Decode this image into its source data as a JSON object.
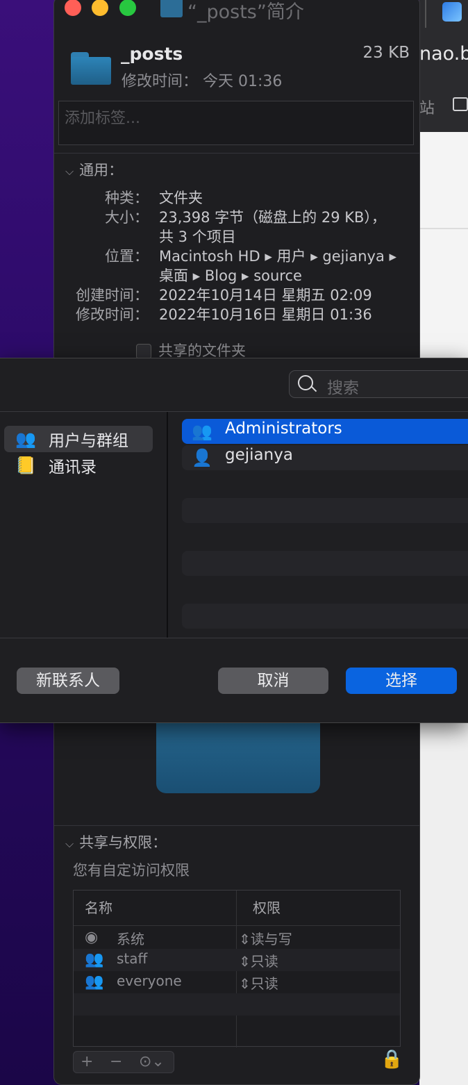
{
  "window": {
    "title": "“_posts”简介"
  },
  "browser": {
    "url_fragment": "nao.ba",
    "toolbar_fragment": "站"
  },
  "info": {
    "name": "_posts",
    "size": "23 KB",
    "modified_short": "修改时间：  今天 01:36",
    "tag_placeholder": "添加标签...",
    "general_section": "通用：",
    "general": [
      {
        "label": "种类：",
        "value": "文件夹"
      },
      {
        "label": "大小：",
        "value": "23,398 字节（磁盘上的 29 KB），"
      },
      {
        "label": "",
        "value": "共 3 个项目"
      },
      {
        "label": "位置：",
        "value": "Macintosh HD ▸ 用户 ▸ gejianya ▸"
      },
      {
        "label": "",
        "value": "桌面 ▸ Blog ▸ source"
      },
      {
        "label": "创建时间：",
        "value": "2022年10月14日 星期五 02:09"
      },
      {
        "label": "修改时间：",
        "value": "2022年10月16日 星期日 01:36"
      }
    ],
    "shared_folder_label": "共享的文件夹",
    "sharing_section": "共享与权限：",
    "custom_access": "您有自定访问权限",
    "perm_headers": {
      "name": "名称",
      "privilege": "权限"
    },
    "perm_rows": [
      {
        "icon": "user-circle-icon",
        "name": "系统",
        "privilege": "读与写"
      },
      {
        "icon": "group-icon",
        "name": "staff",
        "privilege": "只读"
      },
      {
        "icon": "everyone-icon",
        "name": "everyone",
        "privilege": "只读"
      }
    ],
    "perm_footer": {
      "add": "+",
      "remove": "−",
      "more": "⊙⌄"
    }
  },
  "sheet": {
    "search_placeholder": "搜索",
    "sidebar": [
      {
        "label": "用户与群组",
        "selected": true,
        "icon": "users-icon"
      },
      {
        "label": "通讯录",
        "selected": false,
        "icon": "contacts-book-icon"
      }
    ],
    "list": [
      {
        "label": "Administrators",
        "selected": true,
        "icon": "group-icon"
      },
      {
        "label": "gejianya",
        "selected": false,
        "icon": "user-icon"
      }
    ],
    "buttons": {
      "new_contact": "新联系人",
      "cancel": "取消",
      "choose": "选择"
    }
  }
}
